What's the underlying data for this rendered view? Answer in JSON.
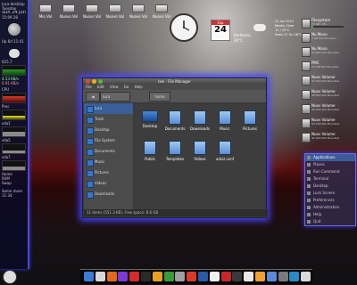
{
  "conky": {
    "host": "luca-desktop",
    "day": "Tuesday",
    "date": "Sun 24 Jun",
    "time": "15:09 28",
    "moon_label": "",
    "uptime": "Up 6d 11:41",
    "temp": "625.7",
    "net_down": "4.53 KB/s",
    "net_up": "0.91 KB/s",
    "cpu_label": "CPU",
    "proc_label": "Proc",
    "ram_label": "RAM",
    "swap_label": "Swap",
    "lines": [
      "sda1",
      "sda5",
      "sda7",
      "Home"
    ],
    "footer_a": "Some more",
    "footer_b": "11:34"
  },
  "desktop_icons": [
    {
      "label": "Mio Vol"
    },
    {
      "label": "Nuovo Vol"
    },
    {
      "label": "Nuovo Vol"
    },
    {
      "label": "Nuovo Vol"
    },
    {
      "label": "Nuovo Vol"
    },
    {
      "label": "Nuovo Vol"
    }
  ],
  "calendar": {
    "day": "24",
    "month": "Giu"
  },
  "weather": {
    "city": "Bertinoro",
    "date": "24 Jun 2012",
    "cond": "Mostly Clear",
    "temp": "29°C",
    "hum": "15 / 29°C",
    "feels": "Feels 37 Hu 28°C"
  },
  "drives": [
    {
      "name": "Filesystem",
      "sub": "72 GB / 5%",
      "fill": 0.05
    },
    {
      "name": "Nu Mono",
      "sub": "2 GB Not Mounted",
      "fill": 0
    },
    {
      "name": "Nu Mono",
      "sub": "87,800 Not Mounted",
      "fill": 0
    },
    {
      "name": "PMC",
      "sub": "2.3 GB Not Mounted",
      "fill": 0
    },
    {
      "name": "Nuov Volume",
      "sub": "37,500 Not Mounted",
      "fill": 0
    },
    {
      "name": "Nuov Volume",
      "sub": "48,800 Not Mounted",
      "fill": 0
    },
    {
      "name": "Nuov Volume",
      "sub": "36,500 Not Mounted",
      "fill": 0
    },
    {
      "name": "Nuov Volume",
      "sub": "57,700 Not Mounted",
      "fill": 0
    },
    {
      "name": "Nuov Volume",
      "sub": "41,000 Not Mounted",
      "fill": 0
    }
  ],
  "file_manager": {
    "title": "Ixel - File Manager",
    "menus": [
      "File",
      "Edit",
      "View",
      "Go",
      "Help"
    ],
    "toolbar_path": "luca",
    "home_label": "home",
    "sidebar": [
      {
        "label": "luca",
        "selected": true
      },
      {
        "label": "Trash",
        "selected": false
      },
      {
        "label": "Desktop",
        "selected": false
      },
      {
        "label": "File System",
        "selected": false
      },
      {
        "label": "Documents",
        "selected": false
      },
      {
        "label": "Music",
        "selected": false
      },
      {
        "label": "Pictures",
        "selected": false
      },
      {
        "label": "Videos",
        "selected": false
      },
      {
        "label": "Downloads",
        "selected": false
      }
    ],
    "items": [
      {
        "label": "Desktop"
      },
      {
        "label": "Documents"
      },
      {
        "label": "Downloads"
      },
      {
        "label": "Music"
      },
      {
        "label": "Pictures"
      },
      {
        "label": "Public"
      },
      {
        "label": "Templates"
      },
      {
        "label": "Videos"
      },
      {
        "label": "adsiz.conf"
      }
    ],
    "status": "11 items (551.3 KB), Free space: 8.6 GB"
  },
  "right_menu": {
    "items": [
      {
        "label": "Applications",
        "selected": true
      },
      {
        "label": "Places",
        "selected": false
      },
      {
        "label": "Run Command",
        "selected": false
      },
      {
        "label": "Terminal",
        "selected": false
      },
      {
        "label": "Desktop",
        "selected": false
      },
      {
        "label": "Lock Screen",
        "selected": false
      },
      {
        "label": "Preferences",
        "selected": false
      },
      {
        "label": "Administration",
        "selected": false
      },
      {
        "label": "Help",
        "selected": false
      },
      {
        "label": "Quit",
        "selected": false
      }
    ]
  },
  "dock": {
    "icon_colors": [
      "#3a7bd5",
      "#d8d8d8",
      "#e06a1a",
      "#7a3ad8",
      "#d82a2a",
      "#2a2a2a",
      "#e8a020",
      "#3a9a3a",
      "#a0a0a0",
      "#d83a2a",
      "#2a5aa8",
      "#f0f0f0",
      "#c82828",
      "#3a3a3a",
      "#e8e8e8",
      "#f0a030",
      "#5a8ad8",
      "#7a7a7a",
      "#2a8ac8",
      "#d8d8d8"
    ],
    "tray_text": ""
  },
  "colors": {
    "accent": "#4a4ad0",
    "selection": "#3a5f9a"
  }
}
